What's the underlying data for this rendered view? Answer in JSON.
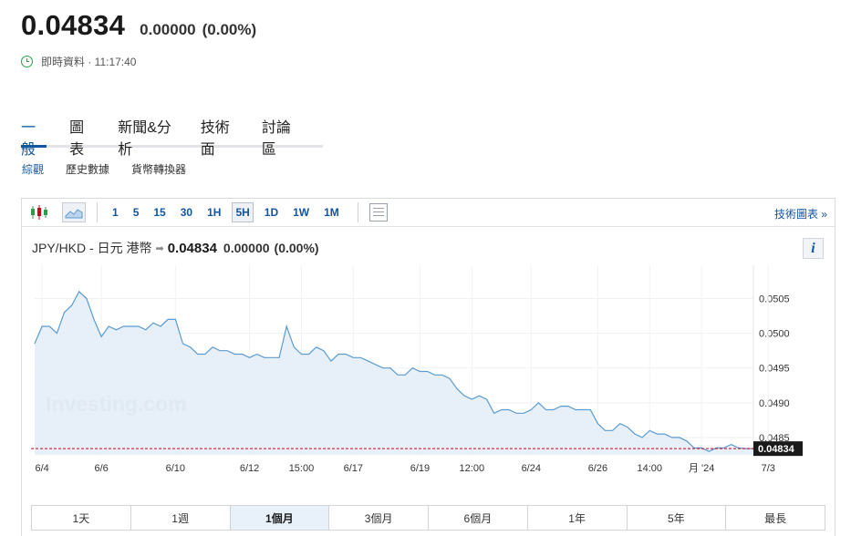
{
  "quote": {
    "price": "0.04834",
    "change": "0.00000",
    "change_pct": "(0.00%)",
    "realtime_label": "即時資料 · 11:17:40"
  },
  "main_tabs": [
    {
      "label": "一般",
      "active": true
    },
    {
      "label": "圖表",
      "active": false
    },
    {
      "label": "新聞&分析",
      "active": false
    },
    {
      "label": "技術面",
      "active": false
    },
    {
      "label": "討論區",
      "active": false
    }
  ],
  "sub_tabs": [
    {
      "label": "綜觀",
      "active": true
    },
    {
      "label": "歷史數據",
      "active": false
    },
    {
      "label": "貨幣轉換器",
      "active": false
    }
  ],
  "toolbar": {
    "icons": [
      "candlestick-icon",
      "area-chart-icon",
      "grid-icon"
    ],
    "intervals": [
      "1",
      "5",
      "15",
      "30",
      "1H",
      "5H",
      "1D",
      "1W",
      "1M"
    ],
    "active_interval": "5H",
    "tech_chart_link": "技術圖表 »"
  },
  "chart_header": {
    "pair": "JPY/HKD - 日元 港幣",
    "price": "0.04834",
    "change": "0.00000",
    "change_pct": "(0.00%)",
    "info": "i"
  },
  "colors": {
    "line": "#5b9bd0",
    "fill": "#e3edf7",
    "accent": "#1256a0",
    "current_line": "#d0021b",
    "price_tag_bg": "#1a1a1a"
  },
  "chart_data": {
    "type": "area",
    "watermark": "Investing.com",
    "y_ticks": [
      0.0485,
      0.049,
      0.0495,
      0.05,
      0.0505
    ],
    "y_range": [
      0.04825,
      0.0509
    ],
    "current_price": 0.04834,
    "current_label": "0.04834",
    "x_ticks": [
      "6/4",
      "6/6",
      "6/10",
      "6/12",
      "15:00",
      "6/17",
      "6/19",
      "12:00",
      "6/24",
      "6/26",
      "14:00",
      "月 '24",
      "7/3"
    ],
    "x_tick_index": [
      1,
      9,
      19,
      29,
      36,
      43,
      52,
      59,
      67,
      76,
      83,
      90,
      99
    ],
    "values": [
      0.04985,
      0.0501,
      0.0501,
      0.05,
      0.0503,
      0.0504,
      0.0506,
      0.0505,
      0.0502,
      0.04995,
      0.0501,
      0.05005,
      0.0501,
      0.0501,
      0.0501,
      0.05005,
      0.05015,
      0.0501,
      0.0502,
      0.0502,
      0.04985,
      0.0498,
      0.0497,
      0.0497,
      0.0498,
      0.04975,
      0.04975,
      0.0497,
      0.0497,
      0.04965,
      0.0497,
      0.04965,
      0.04965,
      0.04965,
      0.0501,
      0.0498,
      0.0497,
      0.0497,
      0.0498,
      0.04975,
      0.0496,
      0.0497,
      0.0497,
      0.04965,
      0.04965,
      0.0496,
      0.04955,
      0.0495,
      0.0495,
      0.0494,
      0.0494,
      0.0495,
      0.04945,
      0.04945,
      0.0494,
      0.0494,
      0.04935,
      0.0492,
      0.0491,
      0.04905,
      0.0491,
      0.04905,
      0.04885,
      0.0489,
      0.0489,
      0.04885,
      0.04885,
      0.0489,
      0.049,
      0.0489,
      0.0489,
      0.04895,
      0.04895,
      0.0489,
      0.0489,
      0.0489,
      0.0487,
      0.0486,
      0.0486,
      0.0487,
      0.04865,
      0.04855,
      0.0485,
      0.0486,
      0.04855,
      0.04855,
      0.0485,
      0.0485,
      0.04845,
      0.04835,
      0.04835,
      0.0483,
      0.04835,
      0.04835,
      0.0484,
      0.04835,
      0.04834,
      0.04834
    ]
  },
  "ranges": [
    {
      "label": "1天",
      "active": false
    },
    {
      "label": "1週",
      "active": false
    },
    {
      "label": "1個月",
      "active": true
    },
    {
      "label": "3個月",
      "active": false
    },
    {
      "label": "6個月",
      "active": false
    },
    {
      "label": "1年",
      "active": false
    },
    {
      "label": "5年",
      "active": false
    },
    {
      "label": "最長",
      "active": false
    }
  ]
}
